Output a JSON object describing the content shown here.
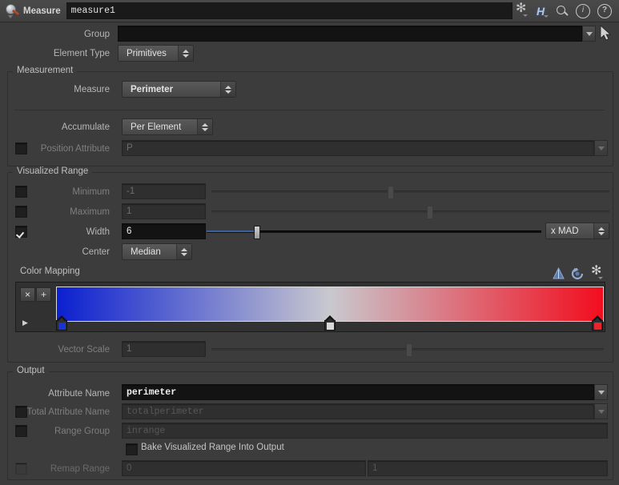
{
  "titlebar": {
    "node_type": "Measure",
    "node_name": "measure1",
    "icons": [
      "asterisk-icon",
      "houdini-h-icon",
      "search-icon",
      "info-icon",
      "help-icon"
    ]
  },
  "top": {
    "group_label": "Group",
    "group_value": "",
    "element_type_label": "Element Type",
    "element_type_value": "Primitives"
  },
  "measurement": {
    "title": "Measurement",
    "measure_label": "Measure",
    "measure_value": "Perimeter",
    "accumulate_label": "Accumulate",
    "accumulate_value": "Per Element",
    "position_attribute_label": "Position Attribute",
    "position_attribute_value": "P",
    "position_attribute_checked": false
  },
  "visualized_range": {
    "title": "Visualized Range",
    "minimum_label": "Minimum",
    "minimum_value": "-1",
    "minimum_checked": false,
    "maximum_label": "Maximum",
    "maximum_value": "1",
    "maximum_checked": false,
    "width_label": "Width",
    "width_value": "6",
    "width_checked": true,
    "width_units": "x MAD",
    "center_label": "Center",
    "center_value": "Median"
  },
  "color_mapping": {
    "title": "Color Mapping",
    "remove_key_label": "×",
    "add_key_label": "+",
    "expand_label": "▶",
    "toolbar_icons": [
      "ramp-preset-icon",
      "reverse-ramp-icon",
      "gear-icon"
    ],
    "ramp_colors": [
      "#0b1fd0",
      "#c9c9cf",
      "#f20d1e"
    ],
    "keys": [
      {
        "name": "blue-key",
        "pos": 0,
        "color": "#1a33d6"
      },
      {
        "name": "white-key",
        "pos": 50,
        "color": "#d8d8d8"
      },
      {
        "name": "red-key",
        "pos": 100,
        "color": "#e8252c"
      }
    ],
    "vector_scale_label": "Vector Scale",
    "vector_scale_value": "1"
  },
  "output": {
    "title": "Output",
    "attribute_name_label": "Attribute Name",
    "attribute_name_value": "perimeter",
    "total_attribute_name_label": "Total Attribute Name",
    "total_attribute_name_value": "totalperimeter",
    "total_attribute_name_checked": false,
    "range_group_label": "Range Group",
    "range_group_value": "inrange",
    "range_group_checked": false,
    "bake_label": "Bake Visualized Range Into Output",
    "bake_checked": false,
    "remap_range_label": "Remap Range",
    "remap_range_min": "0",
    "remap_range_max": "1",
    "remap_range_checked": false
  }
}
